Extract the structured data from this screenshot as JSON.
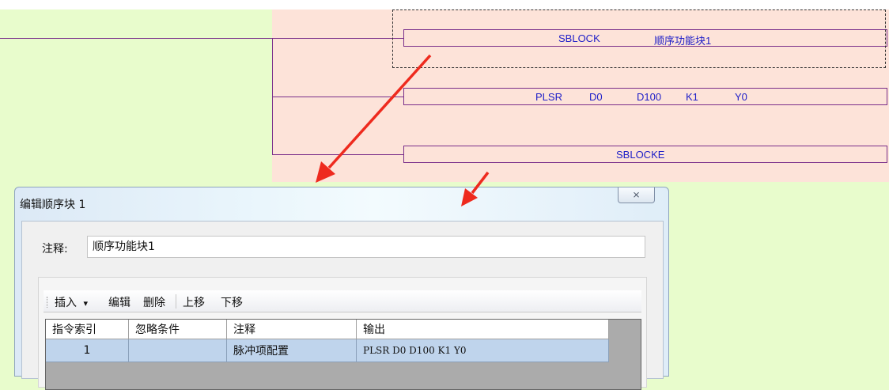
{
  "ladder": {
    "rungs": [
      {
        "op": "SBLOCK",
        "args": [
          "顺序功能块1"
        ]
      },
      {
        "op": "PLSR",
        "args": [
          "D0",
          "D100",
          "K1",
          "Y0"
        ]
      },
      {
        "op": "SBLOCKE",
        "args": []
      }
    ]
  },
  "dialog": {
    "title": "编辑顺序块 1",
    "close_symbol": "⨯",
    "comment_label": "注释:",
    "comment_value": "顺序功能块1",
    "toolbar": {
      "insert": "插入",
      "dropdown_arrow": "▾",
      "edit": "编辑",
      "delete": "删除",
      "move_up": "上移",
      "move_down": "下移"
    },
    "table": {
      "columns": [
        "指令索引",
        "忽略条件",
        "注释",
        "输出"
      ],
      "rows": [
        {
          "index": "1",
          "ignore": "",
          "comment": "脉冲项配置",
          "output": "PLSR D0 D100 K1 Y0"
        }
      ]
    }
  },
  "colors": {
    "background": "#e8fccc",
    "ladder_area": "#fde3d9",
    "ladder_line": "#7a2f8a",
    "ladder_text": "#2020c8",
    "arrow": "#ee2a1e",
    "selected_row": "#bfd4ec"
  }
}
